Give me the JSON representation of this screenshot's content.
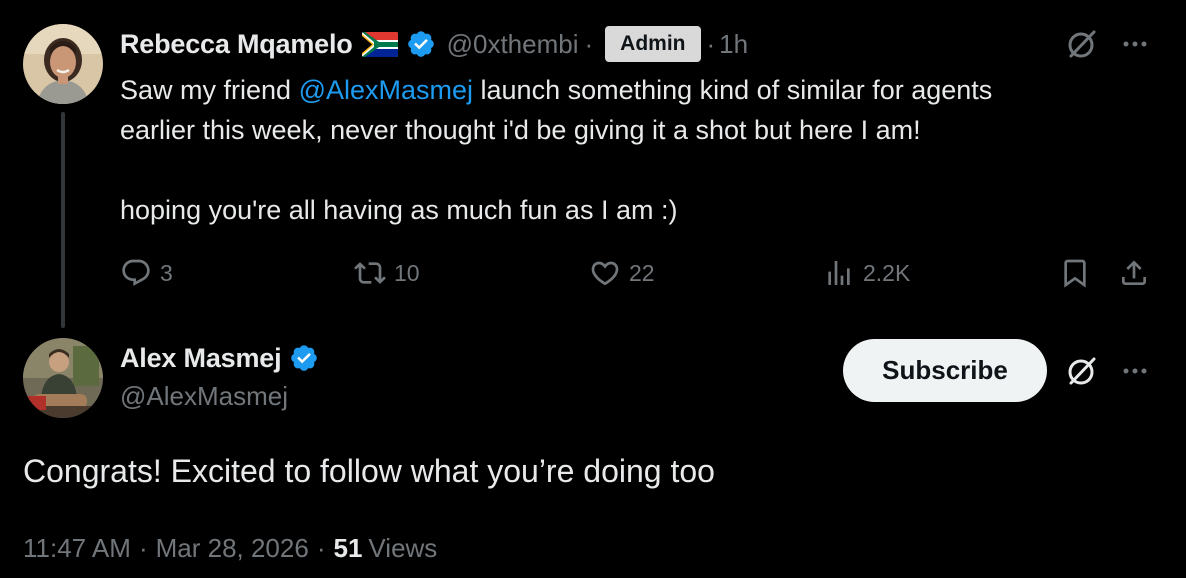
{
  "original_tweet": {
    "author": {
      "name": "Rebecca Mqamelo",
      "handle": "@0xthembi",
      "badge": "Admin",
      "flag": "south-africa-flag",
      "verified_icon": "verified-badge-icon"
    },
    "separator": "·",
    "time_ago": "1h",
    "text": {
      "line1_prefix": "Saw my friend ",
      "mention": "@AlexMasmej",
      "line1_suffix": " launch something kind of similar for agents",
      "line2": "earlier this week, never thought i'd be giving it a shot but here I am!",
      "line3": "hoping you're all having as much fun as I am :)"
    },
    "actions": {
      "replies": "3",
      "reposts": "10",
      "likes": "22",
      "views": "2.2K"
    }
  },
  "reply_tweet": {
    "author": {
      "name": "Alex Masmej",
      "handle": "@AlexMasmej",
      "verified_icon": "verified-badge-icon"
    },
    "subscribe_label": "Subscribe",
    "text": "Congrats! Excited to follow what you’re doing too",
    "meta": {
      "time": "11:47 AM",
      "separator": "·",
      "date": "Mar 28, 2026",
      "views_count": "51",
      "views_label": "Views"
    }
  },
  "colors": {
    "background": "#000000",
    "text_primary": "#e7e9ea",
    "text_secondary": "#71767b",
    "link": "#1d9bf0",
    "verified": "#1d9bf0",
    "thread_line": "#333639",
    "subscribe_bg": "#eff3f4"
  }
}
